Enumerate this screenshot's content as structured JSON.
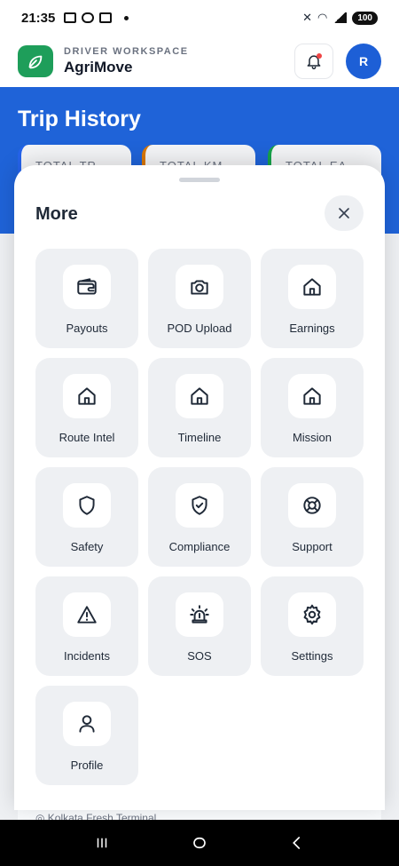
{
  "status_bar": {
    "time": "21:35",
    "battery": "100"
  },
  "header": {
    "subtitle": "DRIVER WORKSPACE",
    "title": "AgriMove",
    "avatar_initial": "R"
  },
  "hero": {
    "title": "Trip History",
    "stats": [
      "TOTAL TR",
      "TOTAL KM",
      "TOTAL EA"
    ]
  },
  "peek_text": "◎ Kolkata Fresh Terminal",
  "sheet": {
    "title": "More",
    "tiles": [
      {
        "label": "Payouts",
        "icon": "wallet-icon"
      },
      {
        "label": "POD Upload",
        "icon": "camera-icon"
      },
      {
        "label": "Earnings",
        "icon": "home-icon"
      },
      {
        "label": "Route Intel",
        "icon": "home-icon"
      },
      {
        "label": "Timeline",
        "icon": "home-icon"
      },
      {
        "label": "Mission",
        "icon": "home-icon"
      },
      {
        "label": "Safety",
        "icon": "shield-icon"
      },
      {
        "label": "Compliance",
        "icon": "shield-check-icon"
      },
      {
        "label": "Support",
        "icon": "lifebuoy-icon"
      },
      {
        "label": "Incidents",
        "icon": "warning-icon"
      },
      {
        "label": "SOS",
        "icon": "siren-icon"
      },
      {
        "label": "Settings",
        "icon": "gear-icon"
      },
      {
        "label": "Profile",
        "icon": "user-icon"
      }
    ]
  },
  "colors": {
    "brand_green": "#1e9e5a",
    "primary_blue": "#1f63d8",
    "tile_bg": "#eef0f3"
  }
}
